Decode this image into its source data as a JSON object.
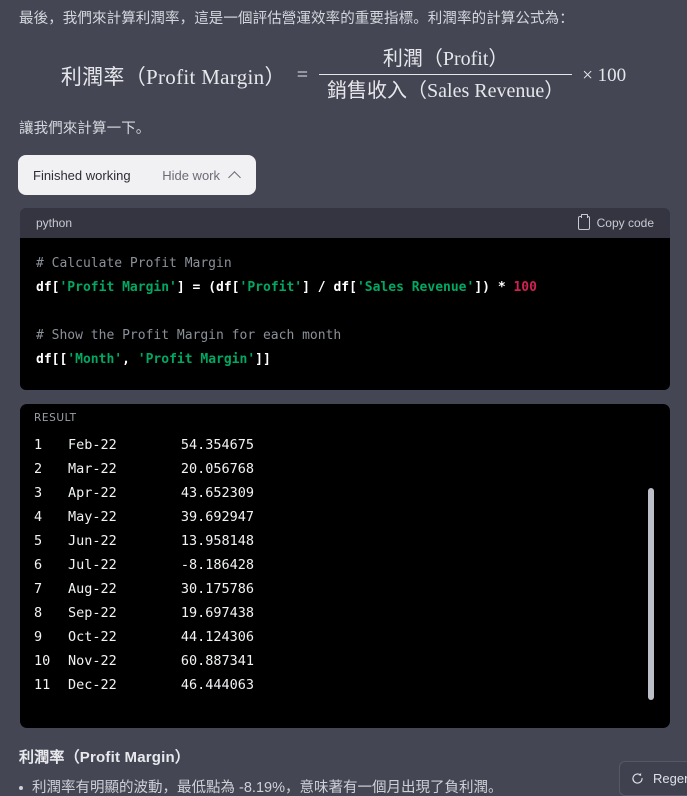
{
  "intro": {
    "paragraph": "最後，我們來計算利潤率，這是一個評估營運效率的重要指標。利潤率的計算公式為："
  },
  "formula": {
    "lhs": "利潤率（Profit Margin）",
    "equals": "=",
    "numerator": "利潤（Profit）",
    "denominator": "銷售收入（Sales Revenue）",
    "tail": "× 100"
  },
  "lets_calculate": "讓我們來計算一下。",
  "work_pill": {
    "status_label": "Finished working",
    "toggle_label": "Hide work",
    "chevron_icon": "chevron-up-icon"
  },
  "code_block": {
    "language": "python",
    "copy_label": "Copy code",
    "copy_icon": "clipboard-icon",
    "lines": [
      {
        "type": "comment",
        "text": "# Calculate Profit Margin"
      },
      {
        "type": "code",
        "text": "df['Profit Margin'] = (df['Profit'] / df['Sales Revenue']) * 100"
      },
      {
        "type": "blank",
        "text": ""
      },
      {
        "type": "comment",
        "text": "# Show the Profit Margin for each month"
      },
      {
        "type": "code",
        "text": "df[['Month', 'Profit Margin']]"
      }
    ]
  },
  "result": {
    "label": "RESULT",
    "rows": [
      {
        "index": "1",
        "month": "Feb-22",
        "value": "54.354675"
      },
      {
        "index": "2",
        "month": "Mar-22",
        "value": "20.056768"
      },
      {
        "index": "3",
        "month": "Apr-22",
        "value": "43.652309"
      },
      {
        "index": "4",
        "month": "May-22",
        "value": "39.692947"
      },
      {
        "index": "5",
        "month": "Jun-22",
        "value": "13.958148"
      },
      {
        "index": "6",
        "month": "Jul-22",
        "value": "-8.186428"
      },
      {
        "index": "7",
        "month": "Aug-22",
        "value": "30.175786"
      },
      {
        "index": "8",
        "month": "Sep-22",
        "value": "19.697438"
      },
      {
        "index": "9",
        "month": "Oct-22",
        "value": "44.124306"
      },
      {
        "index": "10",
        "month": "Nov-22",
        "value": "60.887341"
      },
      {
        "index": "11",
        "month": "Dec-22",
        "value": "46.444063"
      }
    ]
  },
  "analysis": {
    "heading": "利潤率（Profit Margin）",
    "bullet": "利潤率有明顯的波動，最低點為 -8.19%，意味著有一個月出現了負利潤。"
  },
  "regenerate": {
    "label": "Regenerate",
    "icon": "refresh-icon"
  },
  "colors": {
    "page_background": "#444654",
    "code_header": "#343541",
    "code_body": "#000000",
    "pill_background": "#f1f1f3",
    "string_token": "#00a862",
    "number_token": "#d12052",
    "comment_token": "#8b9199",
    "scrollbar": "#bcbec8"
  }
}
